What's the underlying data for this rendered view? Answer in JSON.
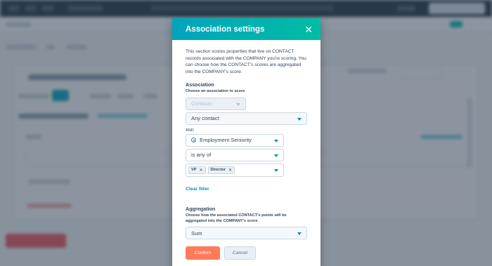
{
  "modal": {
    "title": "Association settings",
    "close_icon": "close-icon",
    "description": "This section scores properties that live on CONTACT records associated with the COMPANY you're scoring. You can choose how the CONTACT's scores are aggregated into the COMPANY's score.",
    "association": {
      "heading": "Association",
      "subheading": "Choose an association to score",
      "association_select": "Contacts",
      "filter_select": "Any contact",
      "and_label": "AND",
      "property_select": "Employment Seniority",
      "operator_select": "is any of",
      "tags": [
        "VP",
        "Director"
      ],
      "clear_filter": "Clear filter"
    },
    "aggregation": {
      "heading": "Aggregation",
      "subheading": "Choose how the associated CONTACT's points will be aggregated into the COMPANY's score",
      "select": "Sum"
    },
    "confirm": "Confirm",
    "cancel": "Cancel"
  },
  "colors": {
    "header_start": "#00a4bd",
    "header_end": "#00bda5",
    "primary_button": "#ff7a59",
    "link": "#0091ae",
    "overlay": "rgba(45,62,80,0.55)"
  }
}
